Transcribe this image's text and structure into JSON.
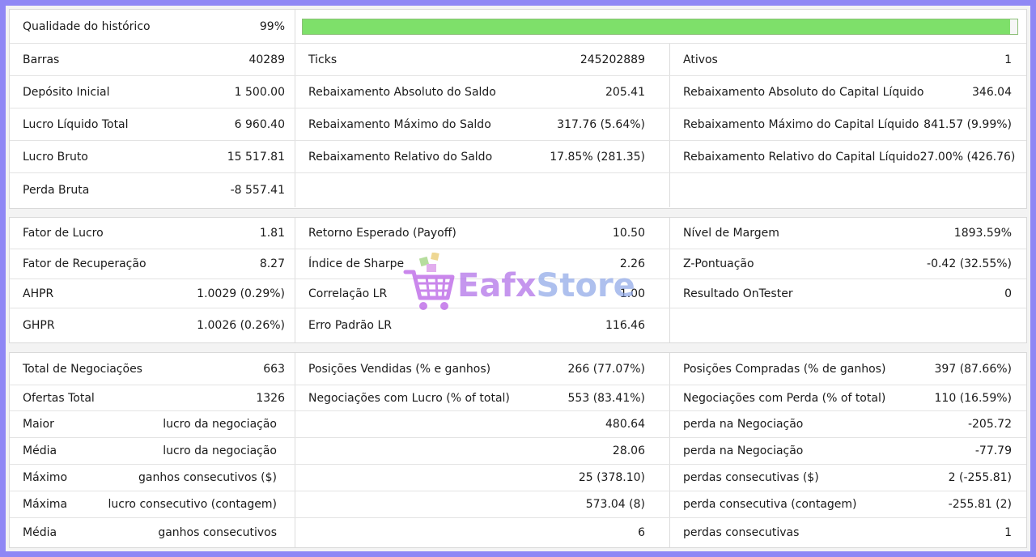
{
  "colors": {
    "background": "#8f87f5",
    "bar_fill": "#7ee06a"
  },
  "history_quality": {
    "label": "Qualidade do histórico",
    "value": "99%",
    "fraction": 0.99
  },
  "section1": {
    "rows": [
      [
        {
          "label": "Barras",
          "value": "40289"
        },
        {
          "label": "Ticks",
          "value": "245202889"
        },
        {
          "label": "Ativos",
          "value": "1"
        }
      ],
      [
        {
          "label": "Depósito Inicial",
          "value": "1 500.00"
        },
        {
          "label": "Rebaixamento Absoluto do Saldo",
          "value": "205.41"
        },
        {
          "label": "Rebaixamento Absoluto do Capital Líquido",
          "value": "346.04"
        }
      ],
      [
        {
          "label": "Lucro Líquido Total",
          "value": "6 960.40"
        },
        {
          "label": "Rebaixamento Máximo do Saldo",
          "value": "317.76 (5.64%)"
        },
        {
          "label": "Rebaixamento Máximo do Capital Líquido",
          "value": "841.57 (9.99%)"
        }
      ],
      [
        {
          "label": "Lucro Bruto",
          "value": "15 517.81"
        },
        {
          "label": "Rebaixamento Relativo do Saldo",
          "value": "17.85% (281.35)"
        },
        {
          "label": "Rebaixamento Relativo do Capital Líquido",
          "value": "27.00% (426.76)"
        }
      ],
      [
        {
          "label": "Perda Bruta",
          "value": "-8 557.41"
        },
        {
          "label": "",
          "value": ""
        },
        {
          "label": "",
          "value": ""
        }
      ]
    ]
  },
  "section2": {
    "rows": [
      [
        {
          "label": "Fator de Lucro",
          "value": "1.81"
        },
        {
          "label": "Retorno Esperado (Payoff)",
          "value": "10.50"
        },
        {
          "label": "Nível de Margem",
          "value": "1893.59%"
        }
      ],
      [
        {
          "label": "Fator de Recuperação",
          "value": "8.27"
        },
        {
          "label": "Índice de Sharpe",
          "value": "2.26"
        },
        {
          "label": "Z-Pontuação",
          "value": "-0.42 (32.55%)"
        }
      ],
      [
        {
          "label": "AHPR",
          "value": "1.0029 (0.29%)"
        },
        {
          "label": "Correlação LR",
          "value": "1.00"
        },
        {
          "label": "Resultado OnTester",
          "value": "0"
        }
      ],
      [
        {
          "label": "GHPR",
          "value": "1.0026 (0.26%)"
        },
        {
          "label": "Erro Padrão LR",
          "value": "116.46"
        },
        {
          "label": "",
          "value": ""
        }
      ]
    ]
  },
  "section3": {
    "rows": [
      [
        {
          "label": "Total de Negociações",
          "value": "663"
        },
        {
          "label": "Posições Vendidas (% e ganhos)",
          "value": "266 (77.07%)"
        },
        {
          "label": "Posições Compradas (% de ganhos)",
          "value": "397 (87.66%)"
        }
      ],
      [
        {
          "label": "Ofertas Total",
          "value": "1326"
        },
        {
          "label": "Negociações com Lucro (% of total)",
          "value": "553 (83.41%)"
        },
        {
          "label": "Negociações com Perda (% of total)",
          "value": "110 (16.59%)"
        }
      ],
      [
        {
          "label": "Maior",
          "mid": "lucro da negociação"
        },
        {
          "label": "",
          "value": "480.64"
        },
        {
          "label": "perda na Negociação",
          "value": "-205.72"
        }
      ],
      [
        {
          "label": "Média",
          "mid": "lucro da negociação"
        },
        {
          "label": "",
          "value": "28.06"
        },
        {
          "label": "perda na Negociação",
          "value": "-77.79"
        }
      ],
      [
        {
          "label": "Máximo",
          "mid": "ganhos consecutivos ($)"
        },
        {
          "label": "",
          "value": "25 (378.10)"
        },
        {
          "label": "perdas consecutivas ($)",
          "value": "2 (-255.81)"
        }
      ],
      [
        {
          "label": "Máxima",
          "mid": "lucro consecutivo (contagem)"
        },
        {
          "label": "",
          "value": "573.04 (8)"
        },
        {
          "label": "perda consecutiva (contagem)",
          "value": "-255.81 (2)"
        }
      ],
      [
        {
          "label": "Média",
          "mid": "ganhos consecutivos"
        },
        {
          "label": "",
          "value": "6"
        },
        {
          "label": "perdas consecutivas",
          "value": "1"
        }
      ]
    ]
  },
  "watermark": {
    "text_a": "Eafx",
    "text_b": "Store",
    "icon": "shopping-cart-icon"
  }
}
